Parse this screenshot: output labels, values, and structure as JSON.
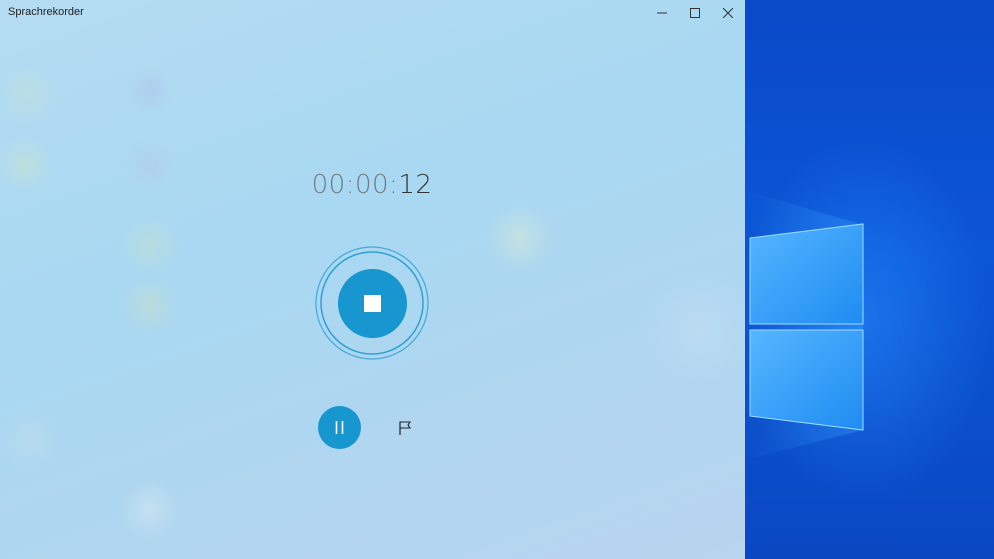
{
  "window": {
    "title": "Sprachrekorder",
    "controls": {
      "minimize": "minimize-icon",
      "maximize": "maximize-icon",
      "close": "close-icon"
    }
  },
  "recorder": {
    "time_hours": "00",
    "sep1": ":",
    "time_minutes": "00",
    "sep2": ":",
    "time_seconds": "12",
    "stop_icon": "stop-icon",
    "pause_icon": "pause-icon",
    "marker_icon": "flag-icon",
    "accent_color": "#1796cf"
  },
  "desktop": {
    "background_color": "#0a4fc4",
    "logo": "windows-logo"
  }
}
